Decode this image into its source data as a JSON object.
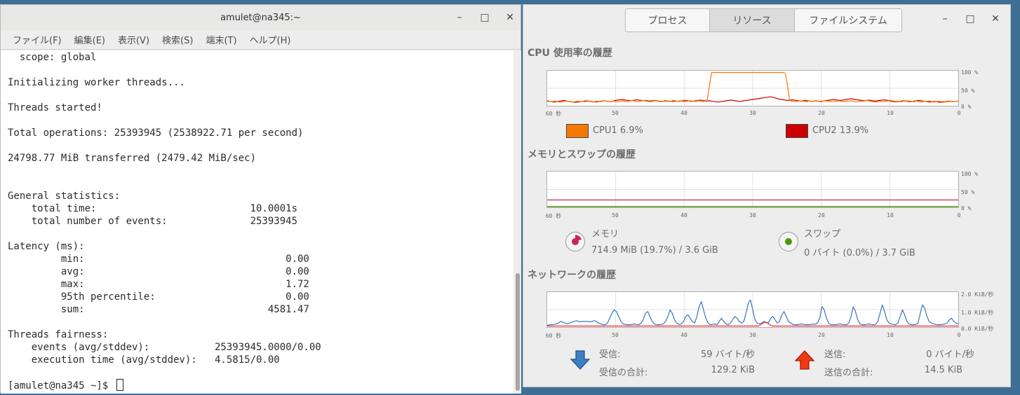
{
  "terminal": {
    "title": "amulet@na345:~",
    "menu": [
      "ファイル(F)",
      "編集(E)",
      "表示(V)",
      "検索(S)",
      "端末(T)",
      "ヘルプ(H)"
    ],
    "lines": [
      "  scope: global",
      "",
      "Initializing worker threads...",
      "",
      "Threads started!",
      "",
      "Total operations: 25393945 (2538922.71 per second)",
      "",
      "24798.77 MiB transferred (2479.42 MiB/sec)",
      "",
      "",
      "General statistics:",
      "    total time:                          10.0001s",
      "    total number of events:              25393945",
      "",
      "Latency (ms):",
      "         min:                                  0.00",
      "         avg:                                  0.00",
      "         max:                                  1.72",
      "         95th percentile:                      0.00",
      "         sum:                               4581.47",
      "",
      "Threads fairness:",
      "    events (avg/stddev):           25393945.0000/0.00",
      "    execution time (avg/stddev):   4.5815/0.00",
      ""
    ],
    "prompt": "[amulet@na345 ~]$ "
  },
  "window_controls": {
    "minimize": "–",
    "maximize": "□",
    "close": "✕"
  },
  "monitor": {
    "tabs": [
      {
        "label": "プロセス",
        "active": false
      },
      {
        "label": "リソース",
        "active": true
      },
      {
        "label": "ファイルシステム",
        "active": false
      }
    ],
    "x_ticks": [
      "60 秒",
      "50",
      "40",
      "30",
      "20",
      "10",
      "0"
    ],
    "cpu": {
      "title": "CPU 使用率の履歴",
      "y_ticks": [
        "100 %",
        "50 %",
        "0 %"
      ],
      "series": [
        {
          "name": "CPU1",
          "label": "CPU1 6.9%",
          "color": "#f57900",
          "values": [
            14,
            12,
            10,
            11,
            12,
            10,
            9,
            10,
            11,
            12,
            11,
            10,
            9,
            10,
            12,
            11,
            10,
            11,
            10,
            12,
            11,
            10,
            9,
            11,
            12,
            10,
            11,
            13,
            12,
            11,
            10,
            12,
            11,
            10,
            11,
            12,
            13,
            11,
            10,
            12,
            14,
            13,
            11,
            10,
            12,
            13,
            14,
            12,
            11,
            10,
            12,
            13,
            12,
            11,
            10,
            12,
            11,
            13,
            12,
            11,
            10,
            12,
            11,
            13,
            12,
            10,
            11,
            12,
            13,
            12,
            11,
            12,
            13,
            11,
            10,
            12,
            18,
            60,
            99,
            99,
            99,
            99,
            99,
            99,
            99,
            99,
            99,
            99,
            99,
            99,
            99,
            99,
            99,
            99,
            99,
            99,
            99,
            99,
            99,
            99,
            99,
            99,
            99,
            99,
            99,
            99,
            99,
            99,
            99,
            99,
            99,
            99,
            99,
            96,
            58,
            15,
            12,
            11,
            10,
            12,
            13,
            12,
            11,
            10,
            12,
            11,
            12,
            13,
            12,
            11,
            10,
            12,
            13,
            11,
            12,
            10,
            12,
            11,
            13,
            12,
            11,
            10,
            12,
            11,
            13,
            12,
            11,
            10,
            12,
            11,
            12,
            13,
            14,
            12,
            11,
            10,
            9,
            11,
            12,
            10,
            11,
            12,
            13,
            11,
            10,
            9,
            12,
            11,
            10,
            12,
            11,
            13,
            12,
            11,
            10,
            12,
            11,
            9,
            10,
            12,
            11,
            13,
            12,
            10,
            9,
            11,
            12,
            10,
            11,
            9,
            10,
            11,
            12,
            10,
            11,
            12
          ]
        },
        {
          "name": "CPU2",
          "label": "CPU2 13.9%",
          "color": "#cc0000",
          "values": [
            12,
            11,
            10,
            9,
            10,
            11,
            12,
            13,
            14,
            12,
            11,
            10,
            9,
            8,
            9,
            10,
            11,
            12,
            13,
            12,
            11,
            10,
            9,
            10,
            11,
            12,
            13,
            12,
            11,
            10,
            12,
            14,
            15,
            16,
            17,
            16,
            15,
            14,
            13,
            14,
            15,
            16,
            15,
            14,
            13,
            14,
            13,
            12,
            13,
            14,
            13,
            12,
            11,
            12,
            13,
            12,
            11,
            12,
            13,
            12,
            11,
            12,
            13,
            14,
            13,
            12,
            11,
            12,
            13,
            14,
            15,
            14,
            13,
            12,
            13,
            12,
            11,
            10,
            9,
            10,
            11,
            12,
            13,
            14,
            15,
            14,
            13,
            12,
            11,
            12,
            13,
            14,
            15,
            16,
            17,
            18,
            19,
            20,
            21,
            22,
            23,
            24,
            25,
            24,
            22,
            20,
            18,
            17,
            16,
            15,
            14,
            15,
            16,
            15,
            14,
            13,
            12,
            13,
            14,
            13,
            12,
            11,
            12,
            13,
            12,
            11,
            12,
            13,
            14,
            15,
            16,
            17,
            16,
            15,
            14,
            15,
            16,
            17,
            18,
            19,
            18,
            17,
            16,
            15,
            14,
            13,
            14,
            15,
            14,
            13,
            12,
            13,
            14,
            15,
            16,
            15,
            14,
            13,
            12,
            11,
            10,
            11,
            12,
            13,
            12,
            11,
            10,
            11,
            12,
            13,
            14,
            13,
            12,
            11,
            10,
            9,
            10,
            11,
            10,
            9,
            8,
            9,
            10,
            11,
            12,
            11,
            10,
            11,
            12
          ]
        }
      ]
    },
    "memory": {
      "title": "メモリとスワップの履歴",
      "y_ticks": [
        "100 %",
        "50 %",
        "0 %"
      ],
      "mem_level": 19.7,
      "swap_level": 0.0,
      "mem_color": "#c82558",
      "swap_color": "#4e9a06",
      "mem_name": "メモリ",
      "mem_value": "714.9 MiB (19.7%) / 3.6 GiB",
      "swap_name": "スワップ",
      "swap_value": "0 バイト (0.0%) / 3.7 GiB"
    },
    "network": {
      "title": "ネットワークの履歴",
      "y_ticks": [
        "2.0 KiB/秒",
        "1.0 KiB/秒",
        "0.0 KiB/秒"
      ],
      "recv_color": "#3874c0",
      "send_color": "#ef2929",
      "recv": [
        0.05,
        0.1,
        0.1,
        0.12,
        0.15,
        0.2,
        0.3,
        0.25,
        0.2,
        0.15,
        0.2,
        0.25,
        0.3,
        0.35,
        0.3,
        0.28,
        0.3,
        0.3,
        0.3,
        0.28,
        0.3,
        0.35,
        0.3,
        0.2,
        0.15,
        0.1,
        0.1,
        0.2,
        0.5,
        0.8,
        1.0,
        0.9,
        0.6,
        0.3,
        0.15,
        0.12,
        0.1,
        0.1,
        0.12,
        0.15,
        0.12,
        0.1,
        0.2,
        0.4,
        0.8,
        0.9,
        0.6,
        0.3,
        0.15,
        0.1,
        0.1,
        0.12,
        0.15,
        0.3,
        0.6,
        1.0,
        0.8,
        0.4,
        0.2,
        0.12,
        0.15,
        0.3,
        0.6,
        0.7,
        0.5,
        0.3,
        0.2,
        0.6,
        1.2,
        1.5,
        1.0,
        0.5,
        0.2,
        0.1,
        0.12,
        0.15,
        0.1,
        0.3,
        0.5,
        0.3,
        0.15,
        0.1,
        0.2,
        0.4,
        0.6,
        0.5,
        0.3,
        0.2,
        0.3,
        0.8,
        1.4,
        1.6,
        1.0,
        0.4,
        0.2,
        0.15,
        0.2,
        0.3,
        0.25,
        0.2,
        0.5,
        0.6,
        0.4,
        0.2,
        0.3,
        0.7,
        0.9,
        0.6,
        0.3,
        0.2,
        0.12,
        0.1,
        0.1,
        0.12,
        0.15,
        0.12,
        0.1,
        0.1,
        0.12,
        0.15,
        0.12,
        0.2,
        0.5,
        1.2,
        1.0,
        0.5,
        0.2,
        0.1,
        0.1,
        0.1,
        0.12,
        0.15,
        0.12,
        0.1,
        0.1,
        0.2,
        0.6,
        1.2,
        0.9,
        0.4,
        0.15,
        0.1,
        0.1,
        0.12,
        0.15,
        0.12,
        0.1,
        0.12,
        0.3,
        0.8,
        1.3,
        0.9,
        0.4,
        0.2,
        0.15,
        0.12,
        0.1,
        0.2,
        0.6,
        1.0,
        0.7,
        0.3,
        0.15,
        0.1,
        0.1,
        0.12,
        0.2,
        0.8,
        1.3,
        1.1,
        0.6,
        0.3,
        0.2,
        0.15,
        0.12,
        0.1,
        0.1,
        0.12,
        0.15,
        0.2,
        0.4,
        0.5,
        0.3,
        0.2,
        0.15
      ],
      "send": [
        0.02,
        0.02,
        0.02,
        0.02,
        0.02,
        0.02,
        0.02,
        0.02,
        0.02,
        0.02,
        0.02,
        0.02,
        0.02,
        0.02,
        0.02,
        0.02,
        0.02,
        0.02,
        0.02,
        0.02,
        0.02,
        0.02,
        0.02,
        0.02,
        0.02,
        0.02,
        0.02,
        0.02,
        0.02,
        0.02,
        0.02,
        0.02,
        0.02,
        0.02,
        0.02,
        0.02,
        0.02,
        0.02,
        0.02,
        0.02,
        0.02,
        0.02,
        0.02,
        0.02,
        0.02,
        0.02,
        0.02,
        0.02,
        0.02,
        0.02,
        0.02,
        0.02,
        0.02,
        0.02,
        0.02,
        0.02,
        0.02,
        0.02,
        0.02,
        0.02,
        0.02,
        0.02,
        0.02,
        0.02,
        0.02,
        0.02,
        0.02,
        0.02,
        0.02,
        0.02,
        0.02,
        0.02,
        0.02,
        0.02,
        0.02,
        0.02,
        0.02,
        0.02,
        0.02,
        0.02,
        0.02,
        0.02,
        0.02,
        0.02,
        0.02,
        0.02,
        0.02,
        0.02,
        0.02,
        0.02,
        0.02,
        0.02,
        0.02,
        0.02,
        0.1,
        0.2,
        0.25,
        0.2,
        0.1,
        0.02,
        0.02,
        0.02,
        0.02,
        0.02,
        0.02,
        0.02,
        0.02,
        0.02,
        0.02,
        0.02,
        0.02,
        0.02,
        0.02,
        0.02,
        0.02,
        0.02,
        0.02,
        0.02,
        0.02,
        0.02,
        0.02,
        0.02,
        0.02,
        0.02,
        0.02,
        0.02,
        0.02,
        0.02,
        0.02,
        0.02,
        0.02,
        0.02,
        0.02,
        0.02,
        0.02,
        0.02,
        0.02,
        0.02,
        0.02,
        0.02,
        0.02,
        0.02,
        0.02,
        0.02,
        0.02,
        0.02,
        0.02,
        0.02,
        0.02,
        0.02,
        0.02,
        0.02,
        0.02,
        0.02,
        0.02,
        0.02,
        0.02,
        0.02,
        0.02,
        0.02,
        0.02,
        0.02,
        0.02,
        0.02,
        0.02,
        0.02,
        0.02,
        0.02,
        0.02,
        0.02,
        0.02,
        0.02,
        0.02,
        0.02,
        0.02,
        0.02,
        0.02,
        0.02,
        0.02,
        0.02,
        0.02,
        0.02
      ],
      "recv_label": "受信:",
      "recv_rate": "59 バイト/秒",
      "recv_total_label": "受信の合計:",
      "recv_total": "129.2 KiB",
      "send_label": "送信:",
      "send_rate": "0 バイト/秒",
      "send_total_label": "送信の合計:",
      "send_total": "14.5 KiB"
    }
  }
}
